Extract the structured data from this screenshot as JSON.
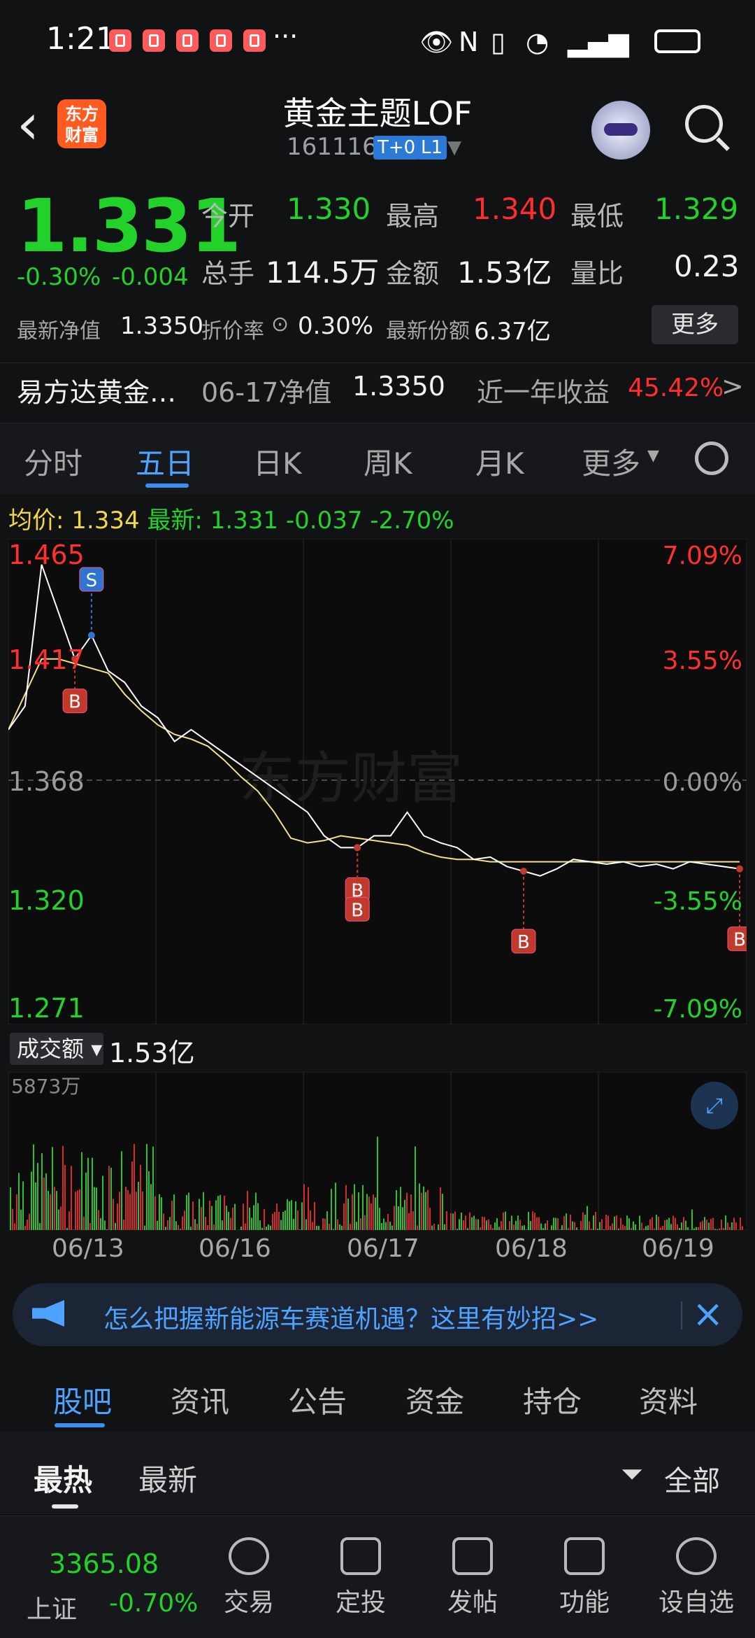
{
  "status_bar": {
    "time": "1:21",
    "more": "···"
  },
  "header": {
    "logo_text": "东方\n财富",
    "title": "黄金主题LOF",
    "code": "161116",
    "tags": [
      "T+0",
      "L1"
    ]
  },
  "quote": {
    "price": "1.331",
    "change_pct": "-0.30%",
    "change_abs": "-0.004",
    "open_label": "今开",
    "open": "1.330",
    "high_label": "最高",
    "high": "1.340",
    "low_label": "最低",
    "low": "1.329",
    "volume_label": "总手",
    "volume": "114.5万",
    "amount_label": "金额",
    "amount": "1.53亿",
    "ratio_label": "量比",
    "ratio": "0.23",
    "nav_label": "最新净值",
    "nav": "1.3350",
    "discount_label": "折价率",
    "discount": "0.30%",
    "shares_label": "最新份额",
    "shares": "6.37亿",
    "more_button": "更多"
  },
  "fund_row": {
    "name": "易方达黄金…",
    "nav_date_label": "06-17净值",
    "nav_value": "1.3350",
    "return_label": "近一年收益",
    "return_value": "45.42%",
    "arrow": ">"
  },
  "tabs": {
    "items": [
      "分时",
      "五日",
      "日K",
      "周K",
      "月K",
      "更多"
    ],
    "active": "五日"
  },
  "avg_line": {
    "avg_label": "均价:",
    "avg_value": "1.334",
    "latest_label": "最新:",
    "latest_value": "1.331",
    "chg_abs": "-0.037",
    "chg_pct": "-2.70%"
  },
  "chart_data": {
    "type": "line",
    "title": "",
    "y_ticks_left": [
      "1.465",
      "1.417",
      "1.368",
      "1.320",
      "1.271"
    ],
    "y_ticks_right": [
      "7.09%",
      "3.55%",
      "0.00%",
      "-3.55%",
      "-7.09%"
    ],
    "ylim": [
      1.271,
      1.465
    ],
    "baseline": 1.368,
    "x_dates": [
      "06/13",
      "06/16",
      "06/17",
      "06/18",
      "06/19"
    ],
    "series": [
      {
        "values": [
          1.39,
          1.4,
          1.46,
          1.44,
          1.42,
          1.43,
          1.415,
          1.41,
          1.4,
          1.395,
          1.385,
          1.39,
          1.385,
          1.38,
          1.375,
          1.37,
          1.365,
          1.36,
          1.355,
          1.345,
          1.34,
          1.34,
          1.345,
          1.345,
          1.355,
          1.345,
          1.342,
          1.34,
          1.335,
          1.336,
          1.332,
          1.33,
          1.328,
          1.331,
          1.335,
          1.334,
          1.333,
          1.334,
          1.332,
          1.333,
          1.331,
          1.334,
          1.333,
          1.332,
          1.331
        ]
      },
      {
        "values": [
          1.39,
          1.405,
          1.42,
          1.42,
          1.418,
          1.416,
          1.414,
          1.405,
          1.398,
          1.392,
          1.388,
          1.386,
          1.383,
          1.377,
          1.37,
          1.364,
          1.355,
          1.344,
          1.342,
          1.343,
          1.345,
          1.344,
          1.343,
          1.342,
          1.341,
          1.338,
          1.336,
          1.335,
          1.335,
          1.334,
          1.334,
          1.334,
          1.334,
          1.334,
          1.334,
          1.334,
          1.334,
          1.334,
          1.334,
          1.334,
          1.334,
          1.334,
          1.334,
          1.334,
          1.334
        ]
      }
    ],
    "markers": [
      "S",
      "B",
      "B",
      "B",
      "B",
      "B"
    ]
  },
  "volume": {
    "selector": "成交额",
    "total": "1.53亿",
    "max_label": "5873万"
  },
  "banner": {
    "text": "怎么把握新能源车赛道机遇？这里有妙招>>"
  },
  "subtabs": {
    "items": [
      "股吧",
      "资讯",
      "公告",
      "资金",
      "持仓",
      "资料"
    ],
    "active": "股吧"
  },
  "sortbar": {
    "hot": "最热",
    "new": "最新",
    "filter": "全部"
  },
  "bottom_nav": {
    "index_value": "3365.08",
    "index_name": "上证",
    "index_change": "-0.70%",
    "items": [
      "交易",
      "定投",
      "发帖",
      "功能",
      "设自选"
    ]
  }
}
